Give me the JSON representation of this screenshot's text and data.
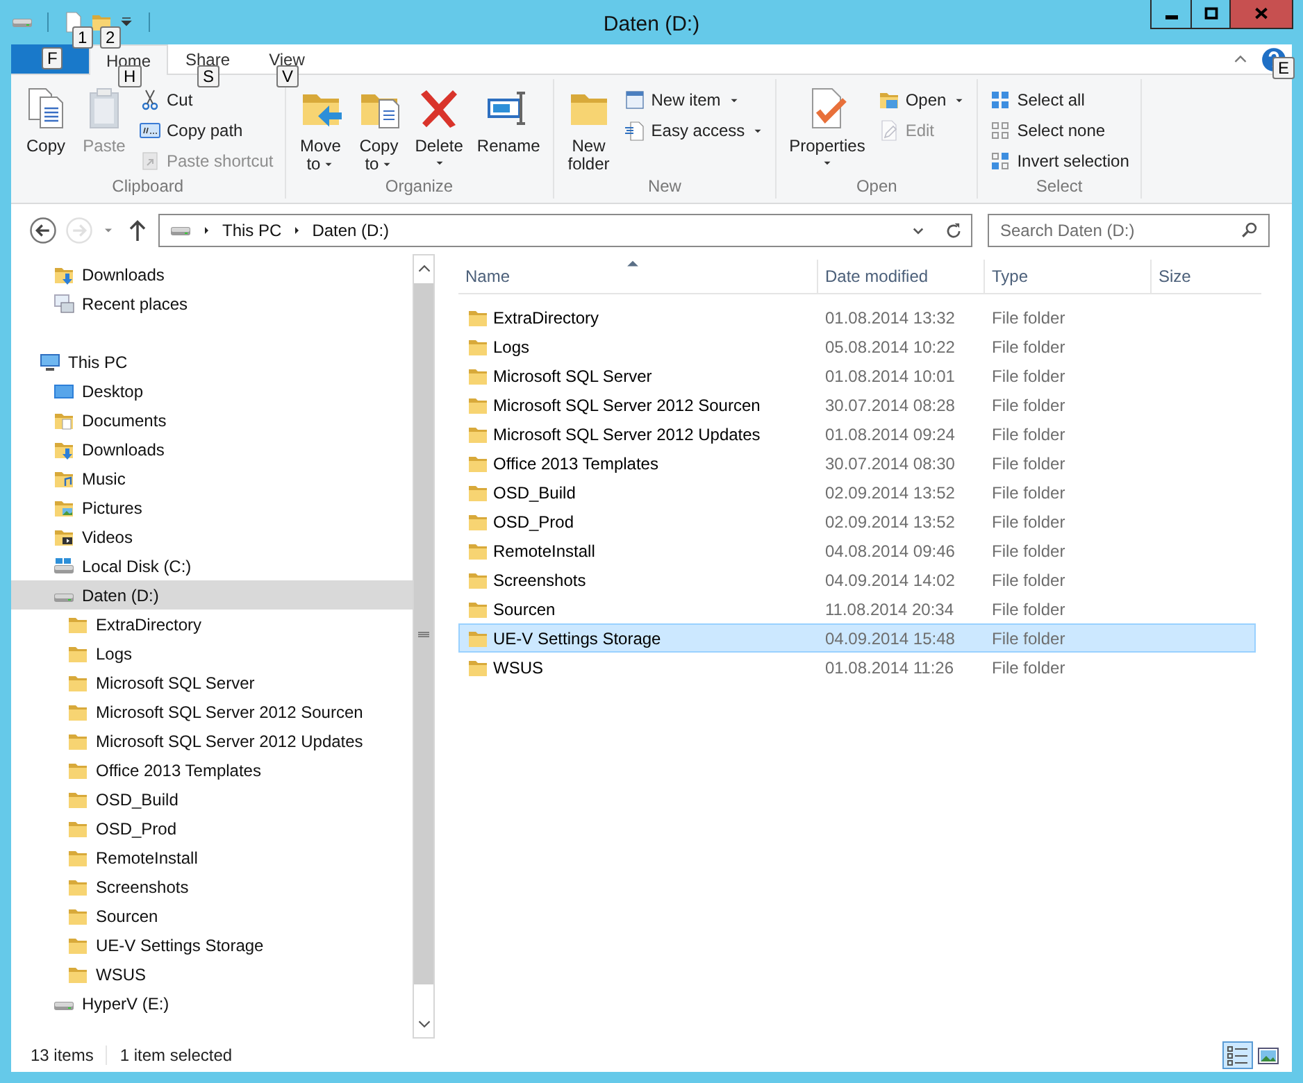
{
  "window": {
    "title": "Daten (D:)"
  },
  "quick_access": {
    "keytips": [
      "1",
      "2"
    ]
  },
  "ribbon": {
    "file_tab": {
      "keytip": "F"
    },
    "tabs": [
      {
        "label": "Home",
        "keytip": "H",
        "selected": true
      },
      {
        "label": "Share",
        "keytip": "S",
        "selected": false
      },
      {
        "label": "View",
        "keytip": "V",
        "selected": false
      }
    ],
    "help_keytip": "E",
    "groups": [
      {
        "name": "Clipboard",
        "items": [
          {
            "kind": "large",
            "label": "Copy",
            "disabled": false
          },
          {
            "kind": "large",
            "label": "Paste",
            "disabled": true
          },
          {
            "kind": "small",
            "label": "Cut",
            "disabled": false
          },
          {
            "kind": "small",
            "label": "Copy path",
            "disabled": false
          },
          {
            "kind": "small",
            "label": "Paste shortcut",
            "disabled": true
          }
        ]
      },
      {
        "name": "Organize",
        "items": [
          {
            "kind": "large",
            "label": "Move to",
            "dropdown": true,
            "disabled": false
          },
          {
            "kind": "large",
            "label": "Copy to",
            "dropdown": true,
            "disabled": false
          },
          {
            "kind": "large",
            "label": "Delete",
            "dropdown": true,
            "disabled": false
          },
          {
            "kind": "large",
            "label": "Rename",
            "disabled": false
          }
        ]
      },
      {
        "name": "New",
        "items": [
          {
            "kind": "large",
            "label": "New folder",
            "disabled": false
          },
          {
            "kind": "small",
            "label": "New item",
            "dropdown": true,
            "disabled": false
          },
          {
            "kind": "small",
            "label": "Easy access",
            "dropdown": true,
            "disabled": false
          }
        ]
      },
      {
        "name": "Open",
        "items": [
          {
            "kind": "large",
            "label": "Properties",
            "dropdown": true,
            "disabled": false
          },
          {
            "kind": "small",
            "label": "Open",
            "dropdown": true,
            "disabled": false
          },
          {
            "kind": "small",
            "label": "Edit",
            "disabled": true
          }
        ]
      },
      {
        "name": "Select",
        "items": [
          {
            "kind": "small",
            "label": "Select all",
            "disabled": false
          },
          {
            "kind": "small",
            "label": "Select none",
            "disabled": false
          },
          {
            "kind": "small",
            "label": "Invert selection",
            "disabled": false
          }
        ]
      }
    ]
  },
  "address_bar": {
    "navigation_buttons": [
      {
        "kind": "back",
        "disabled": false
      },
      {
        "kind": "forward",
        "disabled": true
      },
      {
        "kind": "recent",
        "disabled": false
      },
      {
        "kind": "up",
        "disabled": false
      }
    ],
    "breadcrumb": [
      "This PC",
      "Daten (D:)"
    ],
    "search": {
      "placeholder": "Search Daten (D:)"
    }
  },
  "navigation": {
    "sections": [
      {
        "kind": "favorites",
        "items": [
          {
            "kind": "downloads",
            "label": "Downloads",
            "selected": false
          },
          {
            "kind": "recent",
            "label": "Recent places",
            "selected": false
          }
        ]
      },
      {
        "kind": "computer",
        "items": [
          {
            "kind": "pc",
            "label": "This PC",
            "selected": false,
            "children": [
              {
                "kind": "desktop",
                "label": "Desktop",
                "selected": false
              },
              {
                "kind": "documents",
                "label": "Documents",
                "selected": false
              },
              {
                "kind": "downloads",
                "label": "Downloads",
                "selected": false
              },
              {
                "kind": "music",
                "label": "Music",
                "selected": false
              },
              {
                "kind": "pictures",
                "label": "Pictures",
                "selected": false
              },
              {
                "kind": "videos",
                "label": "Videos",
                "selected": false
              },
              {
                "kind": "system_drive",
                "label": "Local Disk (C:)",
                "selected": false
              },
              {
                "kind": "drive",
                "label": "Daten (D:)",
                "selected": true,
                "children": [
                  {
                    "kind": "folder",
                    "label": "ExtraDirectory",
                    "selected": false
                  },
                  {
                    "kind": "folder",
                    "label": "Logs",
                    "selected": false
                  },
                  {
                    "kind": "folder",
                    "label": "Microsoft SQL Server",
                    "selected": false
                  },
                  {
                    "kind": "folder",
                    "label": "Microsoft SQL Server 2012 Sourcen",
                    "selected": false
                  },
                  {
                    "kind": "folder",
                    "label": "Microsoft SQL Server 2012 Updates",
                    "selected": false
                  },
                  {
                    "kind": "folder",
                    "label": "Office 2013 Templates",
                    "selected": false
                  },
                  {
                    "kind": "folder",
                    "label": "OSD_Build",
                    "selected": false
                  },
                  {
                    "kind": "folder",
                    "label": "OSD_Prod",
                    "selected": false
                  },
                  {
                    "kind": "folder",
                    "label": "RemoteInstall",
                    "selected": false
                  },
                  {
                    "kind": "folder",
                    "label": "Screenshots",
                    "selected": false
                  },
                  {
                    "kind": "folder",
                    "label": "Sourcen",
                    "selected": false
                  },
                  {
                    "kind": "folder",
                    "label": "UE-V Settings Storage",
                    "selected": false
                  },
                  {
                    "kind": "folder",
                    "label": "WSUS",
                    "selected": false
                  }
                ]
              },
              {
                "kind": "drive",
                "label": "HyperV (E:)",
                "selected": false
              }
            ]
          }
        ]
      }
    ]
  },
  "file_list": {
    "columns": [
      {
        "label": "Name",
        "sorted": true
      },
      {
        "label": "Date modified",
        "sorted": false
      },
      {
        "label": "Type",
        "sorted": false
      },
      {
        "label": "Size",
        "sorted": false
      }
    ],
    "rows": [
      {
        "name": "ExtraDirectory",
        "date": "01.08.2014 13:32",
        "type": "File folder",
        "selected": false
      },
      {
        "name": "Logs",
        "date": "05.08.2014 10:22",
        "type": "File folder",
        "selected": false
      },
      {
        "name": "Microsoft SQL Server",
        "date": "01.08.2014 10:01",
        "type": "File folder",
        "selected": false
      },
      {
        "name": "Microsoft SQL Server 2012 Sourcen",
        "date": "30.07.2014 08:28",
        "type": "File folder",
        "selected": false
      },
      {
        "name": "Microsoft SQL Server 2012 Updates",
        "date": "01.08.2014 09:24",
        "type": "File folder",
        "selected": false
      },
      {
        "name": "Office 2013 Templates",
        "date": "30.07.2014 08:30",
        "type": "File folder",
        "selected": false
      },
      {
        "name": "OSD_Build",
        "date": "02.09.2014 13:52",
        "type": "File folder",
        "selected": false
      },
      {
        "name": "OSD_Prod",
        "date": "02.09.2014 13:52",
        "type": "File folder",
        "selected": false
      },
      {
        "name": "RemoteInstall",
        "date": "04.08.2014 09:46",
        "type": "File folder",
        "selected": false
      },
      {
        "name": "Screenshots",
        "date": "04.09.2014 14:02",
        "type": "File folder",
        "selected": false
      },
      {
        "name": "Sourcen",
        "date": "11.08.2014 20:34",
        "type": "File folder",
        "selected": false
      },
      {
        "name": "UE-V Settings Storage",
        "date": "04.09.2014 15:48",
        "type": "File folder",
        "selected": true
      },
      {
        "name": "WSUS",
        "date": "01.08.2014 11:26",
        "type": "File folder",
        "selected": false
      }
    ]
  },
  "status_bar": {
    "item_count": "13 items",
    "selection": "1 item selected",
    "views": [
      {
        "kind": "details",
        "selected": true
      },
      {
        "kind": "large_icons",
        "selected": false
      }
    ]
  }
}
